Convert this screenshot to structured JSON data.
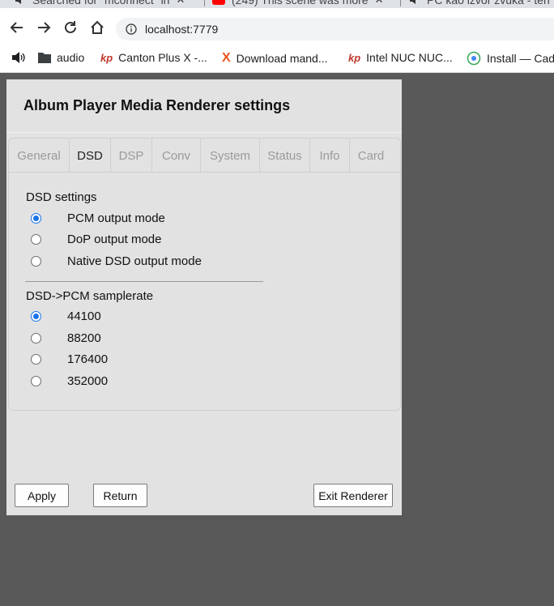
{
  "browser": {
    "tabs": [
      {
        "label": "Searched for \"mconnect\" in",
        "icon": "speaker-icon"
      },
      {
        "label": "(249) This scene was more",
        "icon": "youtube-icon"
      },
      {
        "label": "PC kao izvor zvuka - ten",
        "icon": "speaker-icon"
      }
    ],
    "url": "localhost:7779",
    "bookmarks": [
      {
        "label": "audio",
        "icon": "folder-icon"
      },
      {
        "label": "Canton Plus X -...",
        "icon": "kp-icon",
        "icon_text": "kp"
      },
      {
        "label": "Download mand...",
        "icon": "x-logo-icon",
        "icon_text": "X"
      },
      {
        "label": "Intel NUC NUC...",
        "icon": "kp-icon",
        "icon_text": "kp"
      },
      {
        "label": "Install — Cad",
        "icon": "cadence-icon"
      }
    ]
  },
  "panel": {
    "title": "Album Player Media Renderer settings",
    "tabs": [
      {
        "label": "General",
        "active": false
      },
      {
        "label": "DSD",
        "active": true
      },
      {
        "label": "DSP",
        "active": false
      },
      {
        "label": "Conv",
        "active": false
      },
      {
        "label": "System",
        "active": false
      },
      {
        "label": "Status",
        "active": false
      },
      {
        "label": "Info",
        "active": false
      },
      {
        "label": "Card",
        "active": false
      }
    ],
    "dsd_section": {
      "label": "DSD settings",
      "options": [
        {
          "label": "PCM output mode",
          "checked": true
        },
        {
          "label": "DoP output mode",
          "checked": false
        },
        {
          "label": "Native DSD output mode",
          "checked": false
        }
      ]
    },
    "samplerate_section": {
      "label": "DSD->PCM samplerate",
      "options": [
        {
          "label": "44100",
          "checked": true
        },
        {
          "label": "88200",
          "checked": false
        },
        {
          "label": "176400",
          "checked": false
        },
        {
          "label": "352000",
          "checked": false
        }
      ]
    },
    "buttons": {
      "apply": "Apply",
      "return": "Return",
      "exit": "Exit Renderer"
    }
  },
  "colors": {
    "background": "#595959",
    "panel": "#e2e2e2",
    "radio_accent": "#1a73e8"
  }
}
